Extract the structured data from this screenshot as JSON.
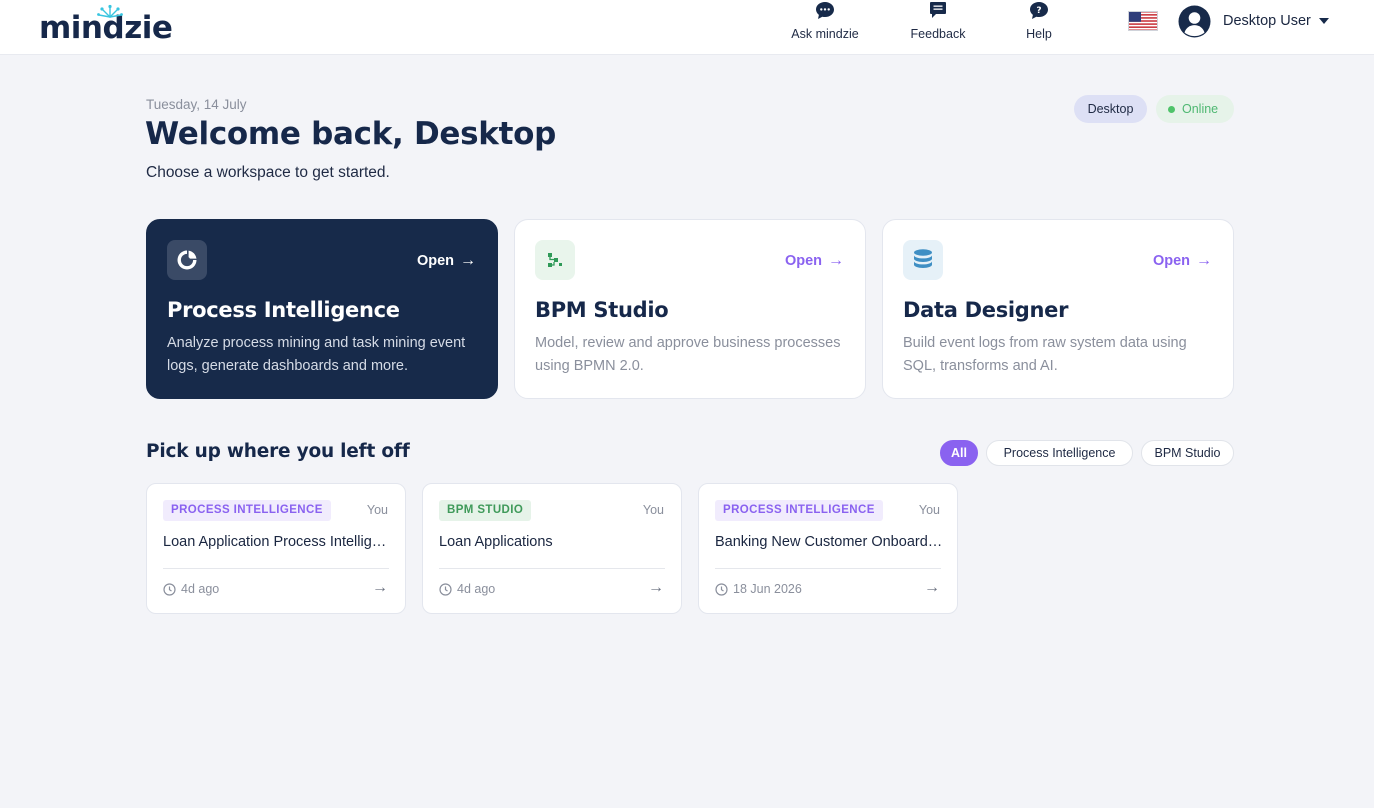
{
  "app": {
    "logo_text": "mindzie"
  },
  "topnav": {
    "ask_label": "Ask mindzie",
    "feedback_label": "Feedback",
    "help_label": "Help",
    "user_name": "Desktop User"
  },
  "header": {
    "date": "Tuesday, 14 July",
    "title": "Welcome back, Desktop",
    "subtitle": "Choose a workspace to get started.",
    "badge_workspace": "Desktop",
    "badge_status": "Online"
  },
  "workspaces": [
    {
      "title": "Process Intelligence",
      "open_label": "Open",
      "description": "Analyze process mining and task mining event logs, generate dashboards and more."
    },
    {
      "title": "BPM Studio",
      "open_label": "Open",
      "description": "Model, review and approve business processes using BPMN 2.0."
    },
    {
      "title": "Data Designer",
      "open_label": "Open",
      "description": "Build event logs from raw system data using SQL, transforms and AI."
    }
  ],
  "recent": {
    "title": "Pick up where you left off",
    "filters": [
      "All",
      "Process Intelligence",
      "BPM Studio"
    ],
    "items": [
      {
        "tag": "PROCESS INTELLIGENCE",
        "owner": "You",
        "name": "Loan Application Process Intelligence",
        "time": "4d ago"
      },
      {
        "tag": "BPM STUDIO",
        "owner": "You",
        "name": "Loan Applications",
        "time": "4d ago"
      },
      {
        "tag": "PROCESS INTELLIGENCE",
        "owner": "You",
        "name": "Banking New Customer Onboarding",
        "time": "18 Jun 2026"
      }
    ]
  },
  "colors": {
    "accent": "#8a62f0",
    "navy": "#172a4a",
    "online": "#4fc36a",
    "background": "#f3f4f8"
  }
}
